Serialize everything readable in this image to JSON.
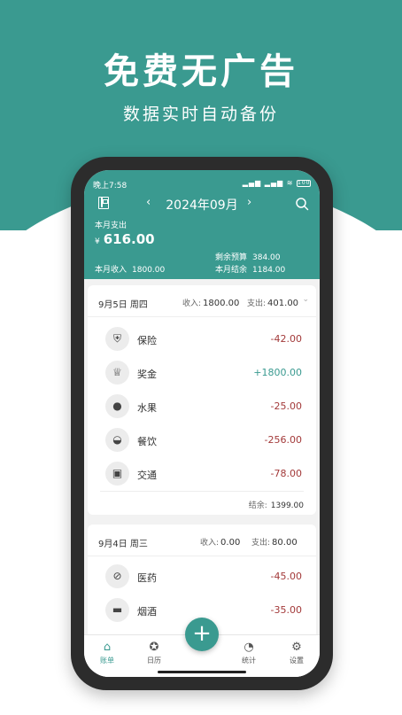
{
  "hero": {
    "title": "免费无广告",
    "subtitle": "数据实时自动备份"
  },
  "status_bar": {
    "time": "晚上7:58",
    "battery": "100"
  },
  "header": {
    "month": "2024年09月",
    "spend_label": "本月支出",
    "currency": "¥",
    "spend_amount": "616.00",
    "remaining_label": "剩余预算",
    "remaining_value": "384.00",
    "income_label": "本月收入",
    "income_value": "1800.00",
    "balance_label": "本月结余",
    "balance_value": "1184.00"
  },
  "days": [
    {
      "date": "9月5日 周四",
      "income_label": "收入:",
      "income": "1800.00",
      "expense_label": "支出:",
      "expense": "401.00",
      "balance_label": "结余:",
      "balance": "1399.00",
      "entries": [
        {
          "icon": "shield-plus-icon",
          "name": "保险",
          "amount": "-42.00"
        },
        {
          "icon": "award-icon",
          "name": "奖金",
          "amount": "+1800.00"
        },
        {
          "icon": "apple-icon",
          "name": "水果",
          "amount": "-25.00"
        },
        {
          "icon": "dish-icon",
          "name": "餐饮",
          "amount": "-256.00"
        },
        {
          "icon": "bus-icon",
          "name": "交通",
          "amount": "-78.00"
        }
      ]
    },
    {
      "date": "9月4日 周三",
      "income_label": "收入:",
      "income": "0.00",
      "expense_label": "支出:",
      "expense": "80.00",
      "entries": [
        {
          "icon": "pill-icon",
          "name": "医药",
          "amount": "-45.00"
        },
        {
          "icon": "cigarette-icon",
          "name": "烟酒",
          "amount": "-35.00"
        }
      ]
    }
  ],
  "tabs": [
    {
      "icon": "home-icon",
      "label": "账单",
      "active": true
    },
    {
      "icon": "calendar-icon",
      "label": "日历",
      "active": false
    },
    {
      "icon": "stats-icon",
      "label": "统计",
      "active": false
    },
    {
      "icon": "gear-icon",
      "label": "设置",
      "active": false
    }
  ],
  "fab": {
    "icon": "plus-icon",
    "label": "+"
  },
  "colors": {
    "accent": "#3a9a90",
    "expense": "#a33a3a",
    "income": "#3a9a90"
  }
}
